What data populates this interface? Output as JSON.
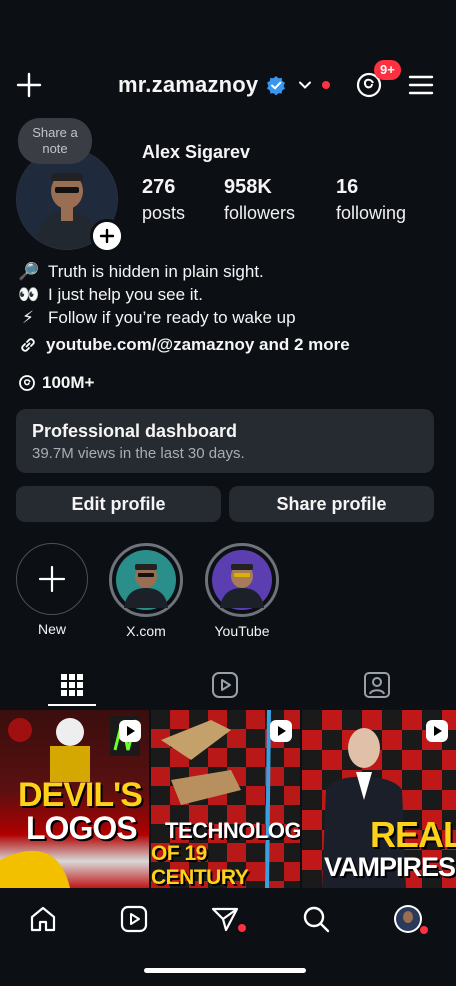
{
  "header": {
    "username": "mr.zamaznoy",
    "threads_badge": "9+"
  },
  "profile": {
    "note_placeholder": "Share a note",
    "full_name": "Alex Sigarev",
    "stats": [
      {
        "value": "276",
        "label": "posts"
      },
      {
        "value": "958K",
        "label": "followers"
      },
      {
        "value": "16",
        "label": "following"
      }
    ],
    "bio": [
      {
        "emoji": "🔎",
        "text": "Truth is hidden in plain sight."
      },
      {
        "emoji": "👀",
        "text": "I just help you see it."
      },
      {
        "emoji": "⚡",
        "text": "Follow if you’re ready to wake up"
      }
    ],
    "link_text": "youtube.com/@zamaznoy and 2 more",
    "threads_followers": "100M+"
  },
  "dashboard": {
    "title": "Professional dashboard",
    "subtitle": "39.7M views in the last 30 days."
  },
  "buttons": {
    "edit": "Edit profile",
    "share": "Share profile"
  },
  "highlights": [
    {
      "label": "New"
    },
    {
      "label": "X.com"
    },
    {
      "label": "YouTube"
    }
  ],
  "tabs": [
    "grid-icon",
    "reels-icon",
    "tagged-icon"
  ],
  "posts": [
    {
      "line1": "DEVIL'S",
      "line2": "LOGOS"
    },
    {
      "line1": "TECHNOLOGY",
      "line2": "OF 19 CENTURY"
    },
    {
      "line1": "REAL",
      "line2": "VAMPIRES"
    }
  ],
  "colors": {
    "background": "#0c0f14",
    "accent_red": "#ff3040",
    "verified_blue": "#3897f0",
    "card": "#262a31",
    "yellow_text": "#ffd21a"
  }
}
